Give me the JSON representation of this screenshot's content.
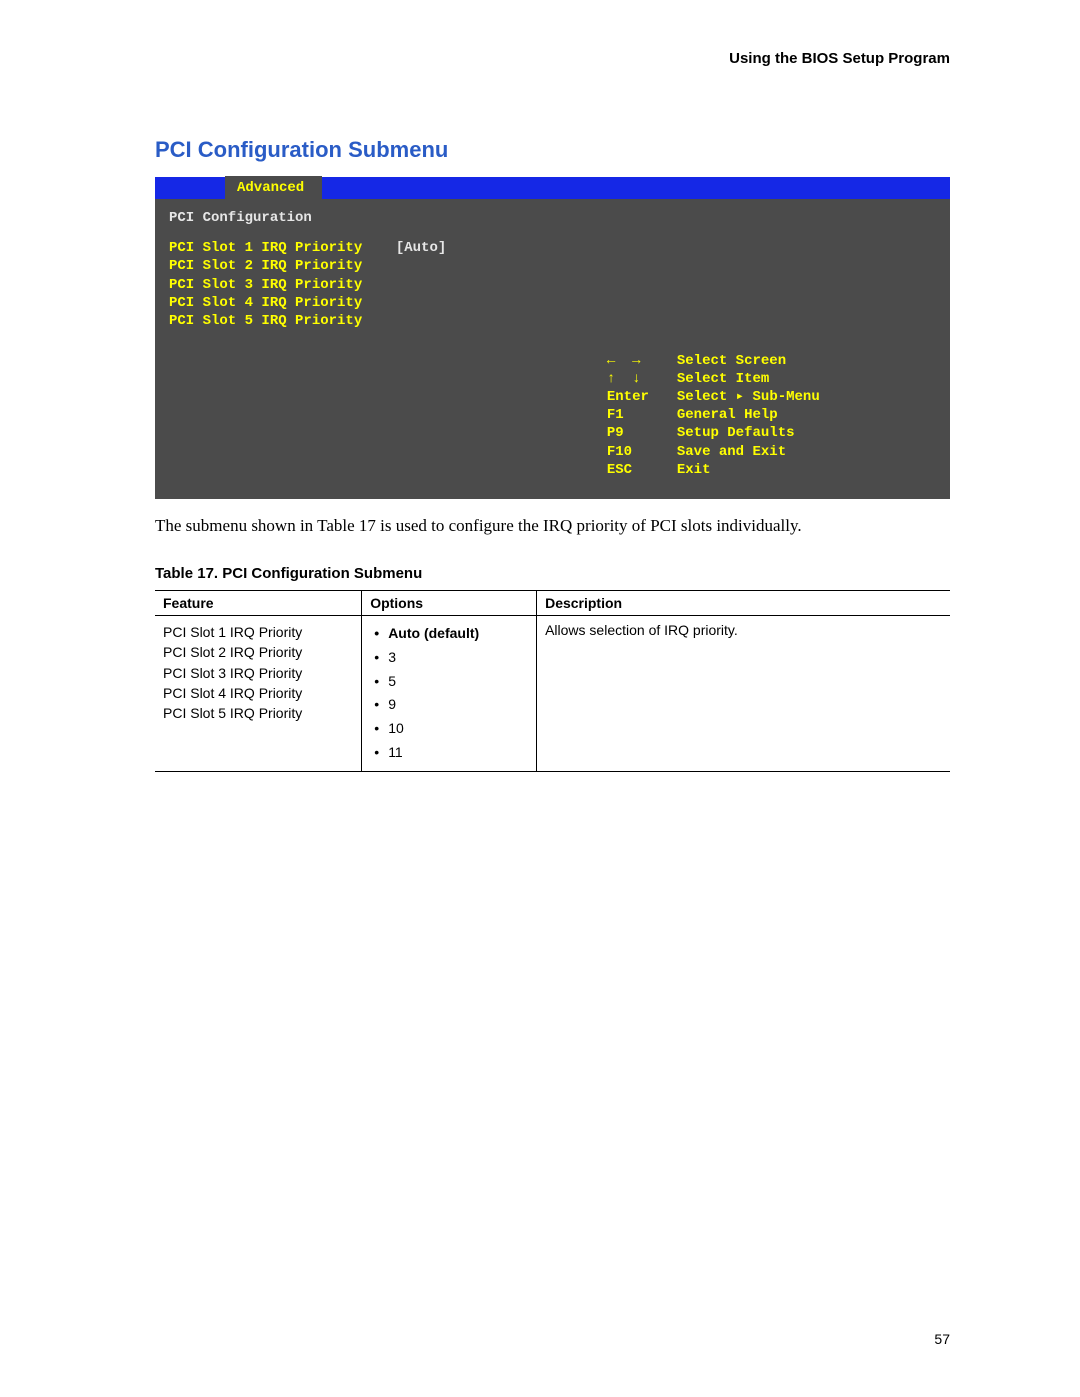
{
  "header": {
    "running": "Using the BIOS Setup Program"
  },
  "section": {
    "heading": "PCI Configuration Submenu"
  },
  "bios": {
    "tab": "Advanced",
    "section_title": "PCI Configuration",
    "items": [
      {
        "label": "PCI Slot 1 IRQ Priority",
        "value": "[Auto]"
      },
      {
        "label": "PCI Slot 2 IRQ Priority",
        "value": ""
      },
      {
        "label": "PCI Slot 3 IRQ Priority",
        "value": ""
      },
      {
        "label": "PCI Slot 4 IRQ Priority",
        "value": ""
      },
      {
        "label": "PCI Slot 5 IRQ Priority",
        "value": ""
      }
    ],
    "help": [
      {
        "key": "←  →",
        "desc": "Select Screen"
      },
      {
        "key": "↑  ↓",
        "desc": "Select Item"
      },
      {
        "key": "Enter",
        "desc": "Select ▸ Sub-Menu"
      },
      {
        "key": "F1",
        "desc": "General Help"
      },
      {
        "key": "P9",
        "desc": "Setup Defaults"
      },
      {
        "key": "F10",
        "desc": "Save and Exit"
      },
      {
        "key": "ESC",
        "desc": "Exit"
      }
    ]
  },
  "caption": "The submenu shown in Table 17 is used to configure the IRQ priority of PCI slots individually.",
  "table": {
    "caption": "Table 17.    PCI Configuration Submenu",
    "headers": {
      "feature": "Feature",
      "options": "Options",
      "description": "Description"
    },
    "features": [
      "PCI Slot 1 IRQ Priority",
      "PCI Slot 2 IRQ Priority",
      "PCI Slot 3 IRQ Priority",
      "PCI Slot 4 IRQ Priority",
      "PCI Slot 5 IRQ Priority"
    ],
    "options": [
      {
        "label": "Auto (default)",
        "default": true
      },
      {
        "label": "3",
        "default": false
      },
      {
        "label": "5",
        "default": false
      },
      {
        "label": "9",
        "default": false
      },
      {
        "label": "10",
        "default": false
      },
      {
        "label": "11",
        "default": false
      }
    ],
    "description": "Allows selection of IRQ priority."
  },
  "page_number": "57"
}
